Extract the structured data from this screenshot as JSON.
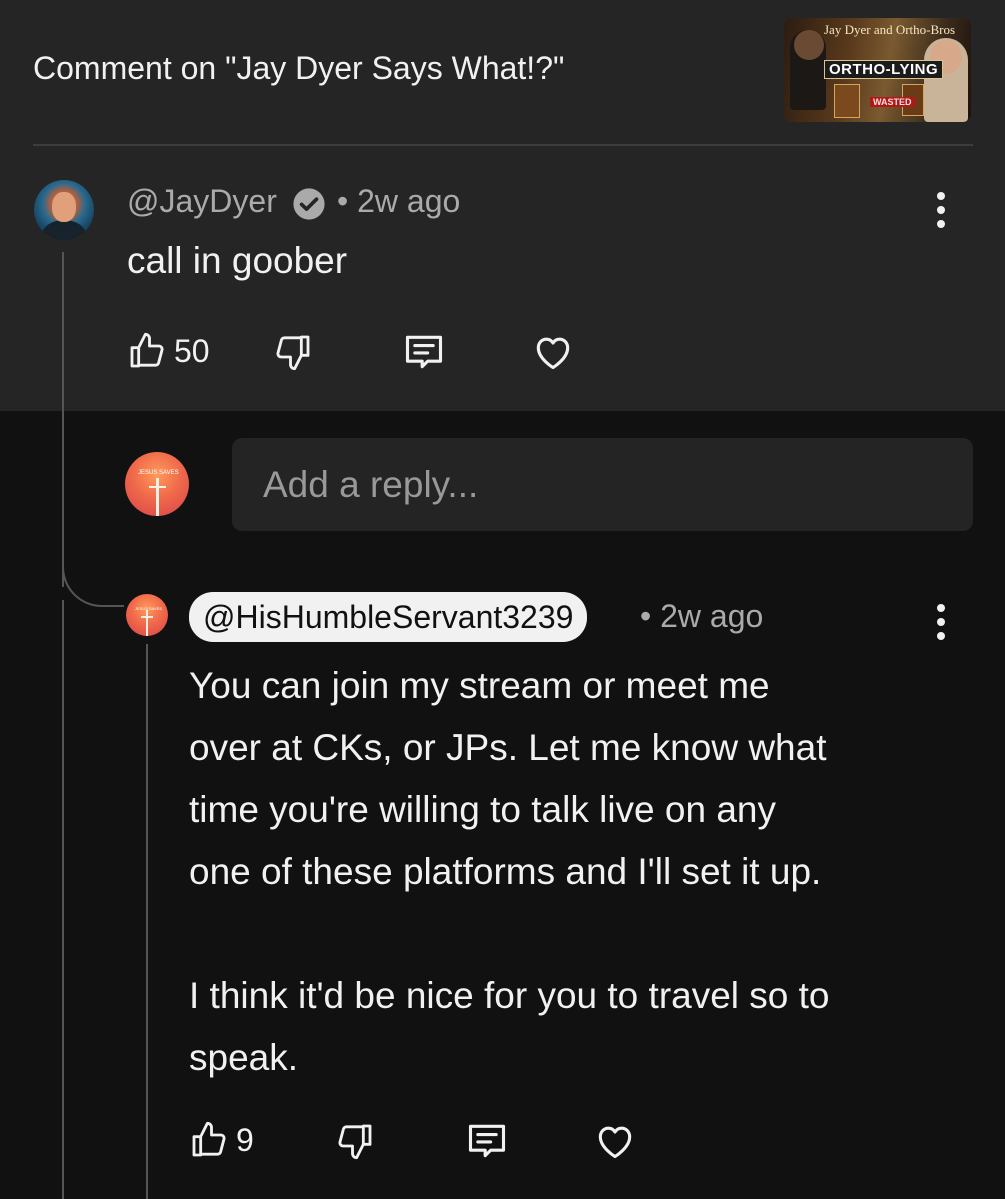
{
  "header": {
    "title": "Comment on \"Jay Dyer Says What!?\"",
    "thumbnail": {
      "line1": "Jay Dyer and Ortho-Bros",
      "line2": "ORTHO-LYING",
      "badge": "WASTED"
    }
  },
  "comment": {
    "author": "@JayDyer",
    "verified_icon": "verified-check-icon",
    "time": "• 2w ago",
    "text": "call in goober",
    "likes": "50"
  },
  "reply_input": {
    "placeholder": "Add a reply..."
  },
  "reply": {
    "author": "@HisHumbleServant3239",
    "time": "• 2w ago",
    "text": "You can join my stream or meet me\nover at CKs, or JPs. Let me know what\ntime you're willing to talk live on any\none of these platforms and I'll set it up.\n\nI think it'd be nice for you to travel so to\nspeak.",
    "likes": "9"
  },
  "avatar_text": "JESUS SAVES",
  "colors": {
    "panel": "#252525",
    "background": "#111111",
    "text": "#f1f1f1",
    "muted": "#aaaaaa"
  }
}
